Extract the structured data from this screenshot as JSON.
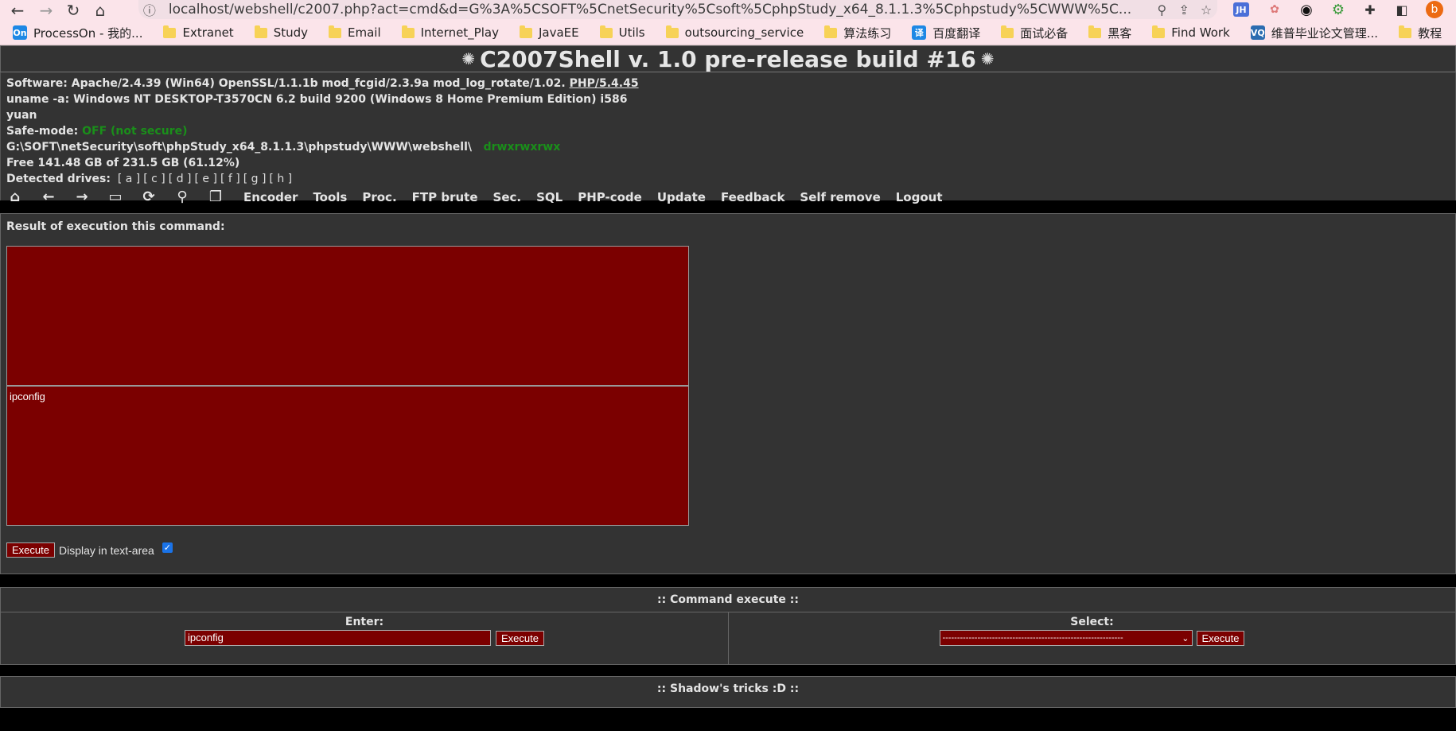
{
  "browser": {
    "url": "localhost/webshell/c2007.php?act=cmd&d=G%3A%5CSOFT%5CnetSecurity%5Csoft%5CphpStudy_x64_8.1.1.3%5Cphpstudy%5CWWW%5C...",
    "profile_initial": "b",
    "bookmarks": [
      {
        "label": "ProcessOn - 我的...",
        "badge": "On",
        "badge_color": "#1e88e5"
      },
      {
        "label": "Extranet"
      },
      {
        "label": "Study"
      },
      {
        "label": "Email"
      },
      {
        "label": "Internet_Play"
      },
      {
        "label": "JavaEE"
      },
      {
        "label": "Utils"
      },
      {
        "label": "outsourcing_service"
      },
      {
        "label": "算法练习"
      },
      {
        "label": "百度翻译",
        "badge": "译",
        "badge_color": "#1e88e5"
      },
      {
        "label": "面试必备"
      },
      {
        "label": "黑客"
      },
      {
        "label": "Find Work"
      },
      {
        "label": "维普毕业论文管理...",
        "badge": "VQ",
        "badge_color": "#2b6cb0"
      },
      {
        "label": "教程"
      }
    ]
  },
  "shell": {
    "title": "C2007Shell v. 1.0 pre-release build #16",
    "software_label": "Software:",
    "software_value": "Apache/2.4.39 (Win64) OpenSSL/1.1.1b mod_fcgid/2.3.9a mod_log_rotate/1.02.",
    "php_link": "PHP/5.4.45",
    "uname_label": "uname -a:",
    "uname_value": "Windows NT DESKTOP-T3570CN 6.2 build 9200 (Windows 8 Home Premium Edition) i586",
    "user": "yuan",
    "safemode_label": "Safe-mode:",
    "safemode_value": "OFF (not secure)",
    "cwd": "G:\\SOFT\\netSecurity\\soft\\phpStudy_x64_8.1.1.3\\phpstudy\\WWW\\webshell\\",
    "perms": "drwxrwxrwx",
    "free_space": "Free 141.48 GB of 231.5 GB (61.12%)",
    "drives_label": "Detected drives:",
    "drives": [
      "[ a ]",
      "[ c ]",
      "[ d ]",
      "[ e ]",
      "[ f ]",
      "[ g ]",
      "[ h ]"
    ],
    "menu": [
      "Encoder",
      "Tools",
      "Proc.",
      "FTP brute",
      "Sec.",
      "SQL",
      "PHP-code",
      "Update",
      "Feedback",
      "Self remove",
      "Logout"
    ]
  },
  "result": {
    "label": "Result of execution this command:",
    "output": "",
    "command": "ipconfig",
    "execute_label": "Execute",
    "display_label": "Display in text-area",
    "display_checked": true
  },
  "command_execute": {
    "title": ":: Command execute ::",
    "enter_label": "Enter:",
    "enter_value": "ipconfig",
    "execute_label": "Execute",
    "select_label": "Select:",
    "select_value": "--------------------------------------------------------------",
    "select_execute_label": "Execute"
  },
  "shadow": {
    "title": ":: Shadow's tricks :D ::"
  }
}
